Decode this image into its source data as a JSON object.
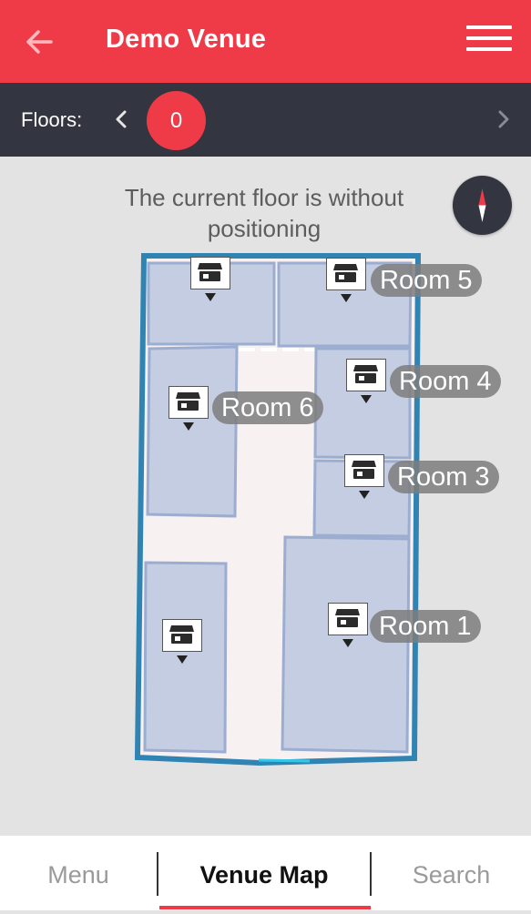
{
  "header": {
    "title": "Demo Venue",
    "back_icon": "arrow-left-icon",
    "menu_icon": "hamburger-menu-icon",
    "color": "#ef3b48"
  },
  "floor_selector": {
    "label": "Floors:",
    "current_floor": "0",
    "prev_icon": "chevron-left-icon",
    "next_icon": "chevron-right-icon"
  },
  "map": {
    "notice": "The current floor is without positioning",
    "compass_icon": "compass-icon",
    "rooms": [
      "Room 5",
      "Room 4",
      "Room 6",
      "Room 3",
      "Room 1"
    ],
    "poi_icon": "shop-icon"
  },
  "bottom_nav": {
    "tabs": [
      "Menu",
      "Venue Map",
      "Search"
    ],
    "active_tab": "Venue Map"
  }
}
